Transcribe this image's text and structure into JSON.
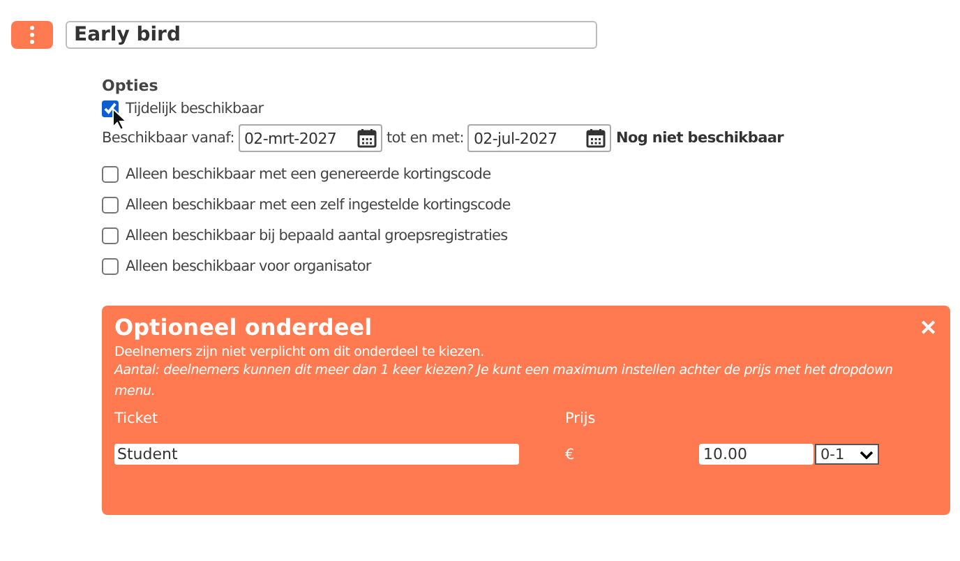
{
  "title_field": {
    "value": "Early bird"
  },
  "options": {
    "heading": "Opties",
    "temporary": {
      "label": "Tijdelijk beschikbaar",
      "checked": true
    },
    "from_label": "Beschikbaar vanaf:",
    "from_value": "02-mrt-2027",
    "to_label": "tot en met:",
    "to_value": "02-jul-2027",
    "status": "Nog niet beschikbaar",
    "checkboxes": [
      {
        "label": "Alleen beschikbaar met een genereerde kortingscode",
        "checked": false
      },
      {
        "label": "Alleen beschikbaar met een zelf ingestelde kortingscode",
        "checked": false
      },
      {
        "label": "Alleen beschikbaar bij bepaald aantal groepsregistraties",
        "checked": false
      },
      {
        "label": "Alleen beschikbaar voor organisator",
        "checked": false
      }
    ]
  },
  "optional_panel": {
    "title": "Optioneel onderdeel",
    "close": "✕",
    "description": "Deelnemers zijn niet verplicht om dit onderdeel te kiezen.",
    "note": "Aantal: deelnemers kunnen dit meer dan 1 keer kiezen? Je kunt een maximum instellen achter de prijs met het dropdown menu.",
    "ticket_header": "Ticket",
    "price_header": "Prijs",
    "ticket_value": "Student",
    "currency": "€",
    "price_value": "10.00",
    "quantity": "0-1"
  }
}
